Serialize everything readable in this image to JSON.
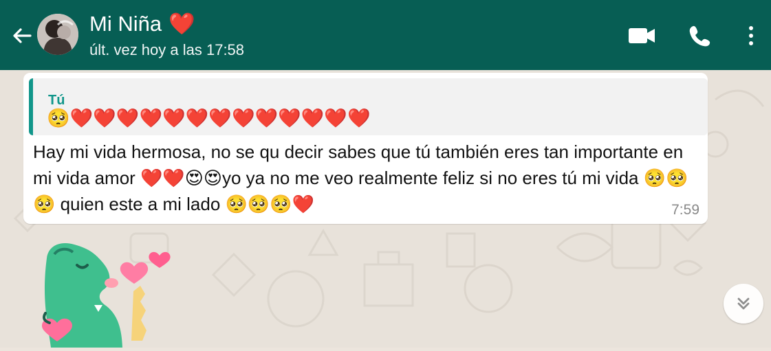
{
  "header": {
    "contact_name": "Mi Niña",
    "last_seen": "últ. vez hoy a las 17:58",
    "title_emoji": "❤️"
  },
  "message": {
    "quoted_author": "Tú",
    "quoted_text": "🥺❤️❤️❤️❤️❤️❤️❤️❤️❤️❤️❤️❤️❤️",
    "text": "Hay mi vida hermosa, no se qu  decir sabes que tú también eres tan importante en mi vida amor ❤️❤️😍😍yo ya no me veo realmente feliz si no eres tú mi vida 🥺🥺🥺 quien este a mi lado 🥺🥺🥺❤️",
    "time": "7:59"
  },
  "icons": {
    "back": "arrow-left-icon",
    "video": "video-call-icon",
    "call": "phone-call-icon",
    "more": "more-vertical-icon",
    "scroll": "chevron-down-double-icon"
  },
  "colors": {
    "header": "#075e54",
    "accent": "#11968a",
    "bubble": "#ffffff",
    "background": "#e8e2da"
  }
}
